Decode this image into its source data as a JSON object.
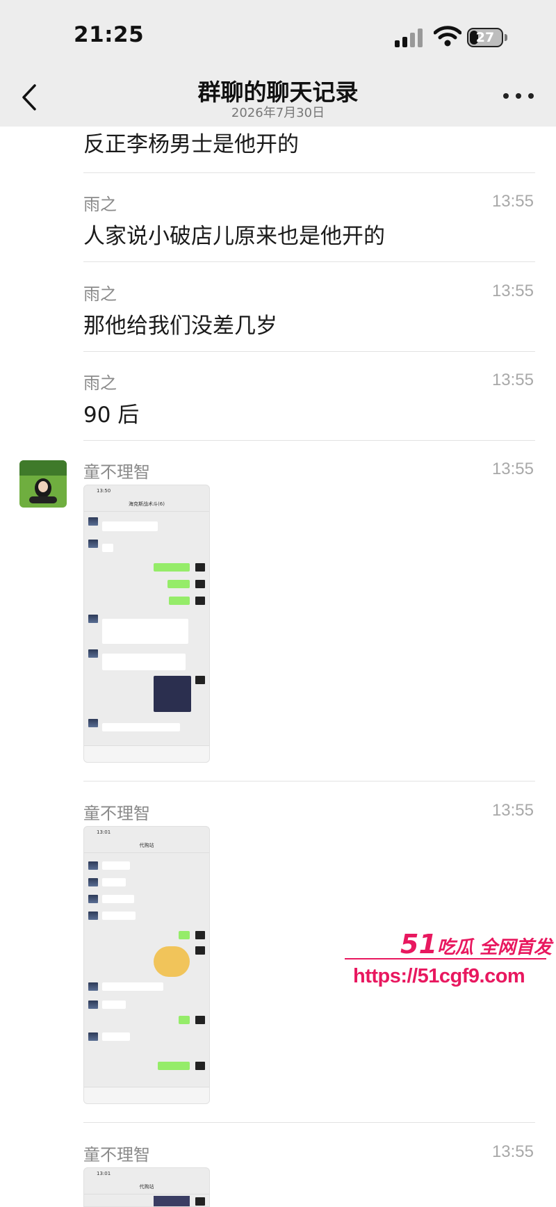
{
  "status_bar": {
    "time": "21:25",
    "battery": "27"
  },
  "nav": {
    "title": "群聊的聊天记录",
    "subtitle": "2026年7月30日"
  },
  "records": [
    {
      "sender": "",
      "time": "",
      "text": "反正李杨男士是他开的"
    },
    {
      "sender": "雨之",
      "time": "13:55",
      "text": "人家说小破店儿原来也是他开的"
    },
    {
      "sender": "雨之",
      "time": "13:55",
      "text": "那他给我们没差几岁"
    },
    {
      "sender": "雨之",
      "time": "13:55",
      "text": "90 后"
    },
    {
      "sender": "童不理智",
      "time": "13:55",
      "text": ""
    },
    {
      "sender": "童不理智",
      "time": "13:55",
      "text": ""
    },
    {
      "sender": "童不理智",
      "time": "13:55",
      "text": ""
    }
  ],
  "screenshots": [
    {
      "status_time": "13:50",
      "title": "海克斯战术斗(6)"
    },
    {
      "status_time": "13:01",
      "title": "代购站"
    },
    {
      "status_time": "13:01",
      "title": "代购站"
    }
  ],
  "watermark": {
    "brand_num": "51",
    "brand_text": "吃瓜 全网首发",
    "url": "https://51cgf9.com"
  },
  "colors": {
    "accent": "#e8185f",
    "bubble_me": "#95ec69",
    "nav_bg": "#ededed"
  }
}
